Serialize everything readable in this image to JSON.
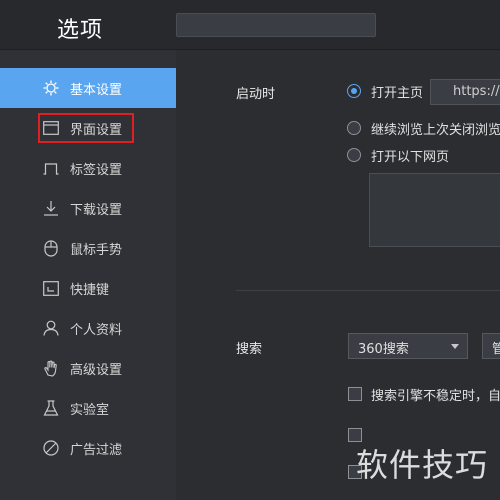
{
  "header": {
    "title": "选项",
    "search_value": ""
  },
  "sidebar": {
    "items": [
      {
        "label": "基本设置",
        "icon": "gear-icon"
      },
      {
        "label": "界面设置",
        "icon": "window-icon"
      },
      {
        "label": "标签设置",
        "icon": "tab-icon"
      },
      {
        "label": "下载设置",
        "icon": "download-icon"
      },
      {
        "label": "鼠标手势",
        "icon": "mouse-icon"
      },
      {
        "label": "快捷键",
        "icon": "keyboard-icon"
      },
      {
        "label": "个人资料",
        "icon": "user-icon"
      },
      {
        "label": "高级设置",
        "icon": "hand-icon"
      },
      {
        "label": "实验室",
        "icon": "flask-icon"
      },
      {
        "label": "广告过滤",
        "icon": "block-icon"
      }
    ],
    "active_index": 0,
    "accent": "#5aa5f0",
    "highlight_color": "#e02020"
  },
  "startup": {
    "label": "启动时",
    "options": [
      "打开主页",
      "继续浏览上次关闭浏览",
      "打开以下网页"
    ],
    "selected_index": 0,
    "homepage_url": "https://h"
  },
  "search": {
    "label": "搜索",
    "engine": "360搜索",
    "manage_label": "管",
    "fallback_checkbox_label": "搜索引擎不稳定时，自",
    "fallback_checked": false
  },
  "watermark": "软件技巧"
}
